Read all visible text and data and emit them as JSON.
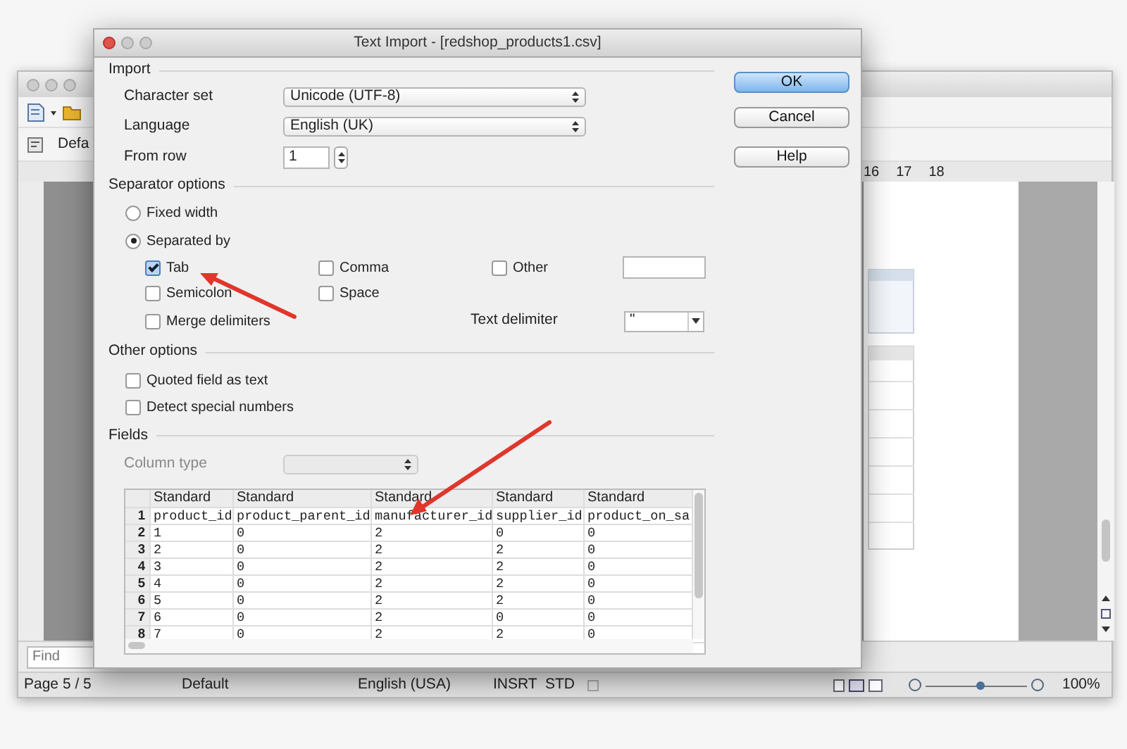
{
  "background_window": {
    "style_box": "Defa",
    "ruler_labels": [
      "16",
      "17",
      "18"
    ],
    "find": {
      "placeholder": "Find"
    },
    "status_bar": {
      "items": [
        "Page 5 / 5",
        "Default",
        "English (USA)",
        "INSRT",
        "STD"
      ],
      "zoom_slider": {
        "level": 0.55
      },
      "zoom": "100%"
    }
  },
  "dialog": {
    "title": "Text Import - [redshop_products1.csv]",
    "import": {
      "heading": "Import",
      "character_set": {
        "label": "Character set",
        "value": "Unicode (UTF-8)"
      },
      "language": {
        "label": "Language",
        "value": "English (UK)"
      },
      "from_row": {
        "label": "From row",
        "value": "1"
      }
    },
    "separator_options": {
      "heading": "Separator options",
      "modes": [
        {
          "label": "Fixed width",
          "selected": false
        },
        {
          "label": "Separated by",
          "selected": true
        }
      ],
      "separators": [
        {
          "label": "Tab",
          "checked": true
        },
        {
          "label": "Comma",
          "checked": false
        },
        {
          "label": "Other",
          "checked": false
        },
        {
          "label": "Semicolon",
          "checked": false
        },
        {
          "label": "Space",
          "checked": false
        }
      ],
      "merge_delimiters": {
        "label": "Merge delimiters",
        "checked": false
      },
      "text_delimiter": {
        "label": "Text delimiter",
        "value": "\""
      }
    },
    "other_options": {
      "heading": "Other options",
      "options": [
        {
          "label": "Quoted field as text",
          "checked": false
        },
        {
          "label": "Detect special numbers",
          "checked": false
        }
      ]
    },
    "fields": {
      "heading": "Fields",
      "column_type": {
        "label": "Column type",
        "disabled": true
      },
      "table": {
        "columns": [
          "Standard",
          "Standard",
          "Standard",
          "Standard",
          "Standard"
        ],
        "rows": [
          {
            "number": "1",
            "cells": [
              "product_id",
              "product_parent_id",
              "manufacturer_id",
              "supplier_id",
              "product_on_sa"
            ]
          },
          {
            "number": "2",
            "cells": [
              "1",
              "0",
              "2",
              "0",
              "0"
            ]
          },
          {
            "number": "3",
            "cells": [
              "2",
              "0",
              "2",
              "2",
              "0"
            ]
          },
          {
            "number": "4",
            "cells": [
              "3",
              "0",
              "2",
              "2",
              "0"
            ]
          },
          {
            "number": "5",
            "cells": [
              "4",
              "0",
              "2",
              "2",
              "0"
            ]
          },
          {
            "number": "6",
            "cells": [
              "5",
              "0",
              "2",
              "2",
              "0"
            ]
          },
          {
            "number": "7",
            "cells": [
              "6",
              "0",
              "2",
              "0",
              "0"
            ]
          },
          {
            "number": "8",
            "cells": [
              "7",
              "0",
              "2",
              "2",
              "0"
            ]
          }
        ]
      }
    },
    "buttons": [
      {
        "label": "OK",
        "default": true
      },
      {
        "label": "Cancel",
        "default": false
      },
      {
        "label": "Help",
        "default": false
      }
    ]
  }
}
